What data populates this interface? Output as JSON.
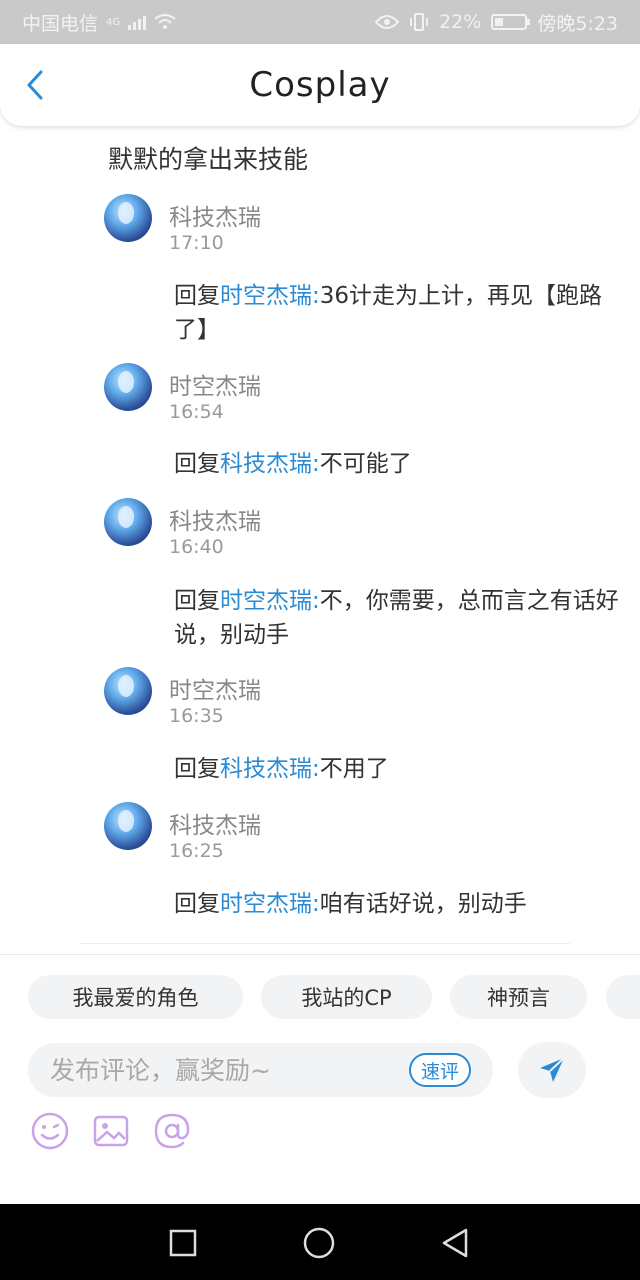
{
  "status_bar": {
    "carrier": "中国电信",
    "network": "4G",
    "battery": "22%",
    "time": "傍晚5:23"
  },
  "header": {
    "title": "Cosplay",
    "back_icon": "chevron-left-icon"
  },
  "comments": {
    "top_text": "默默的拿出来技能",
    "items": [
      {
        "name": "科技杰瑞",
        "time": "17:10",
        "reply_prefix": "回复",
        "reply_to": "时空杰瑞:",
        "reply_text": "36计走为上计，再见【跑路了】"
      },
      {
        "name": "时空杰瑞",
        "time": "16:54",
        "reply_prefix": "回复",
        "reply_to": "科技杰瑞:",
        "reply_text": "不可能了"
      },
      {
        "name": "科技杰瑞",
        "time": "16:40",
        "reply_prefix": "回复",
        "reply_to": "时空杰瑞:",
        "reply_text": "不，你需要，总而言之有话好说，别动手"
      },
      {
        "name": "时空杰瑞",
        "time": "16:35",
        "reply_prefix": "回复",
        "reply_to": "科技杰瑞:",
        "reply_text": "不用了"
      },
      {
        "name": "科技杰瑞",
        "time": "16:25",
        "reply_prefix": "回复",
        "reply_to": "时空杰瑞:",
        "reply_text": "咱有话好说，别动手"
      }
    ]
  },
  "bottom": {
    "chips": [
      "我最爱的角色",
      "我站的CP",
      "神预言"
    ],
    "input_placeholder": "发布评论，赢奖励~",
    "quick_comment_label": "速评",
    "send_icon": "send-icon",
    "tools": [
      "emoji-icon",
      "image-icon",
      "mention-icon"
    ]
  },
  "colors": {
    "accent": "#2a8ad3",
    "status_bar_bg": "#c9c9c9",
    "chip_bg": "#f2f3f5",
    "emoji_purple": "#c9a2e8"
  }
}
